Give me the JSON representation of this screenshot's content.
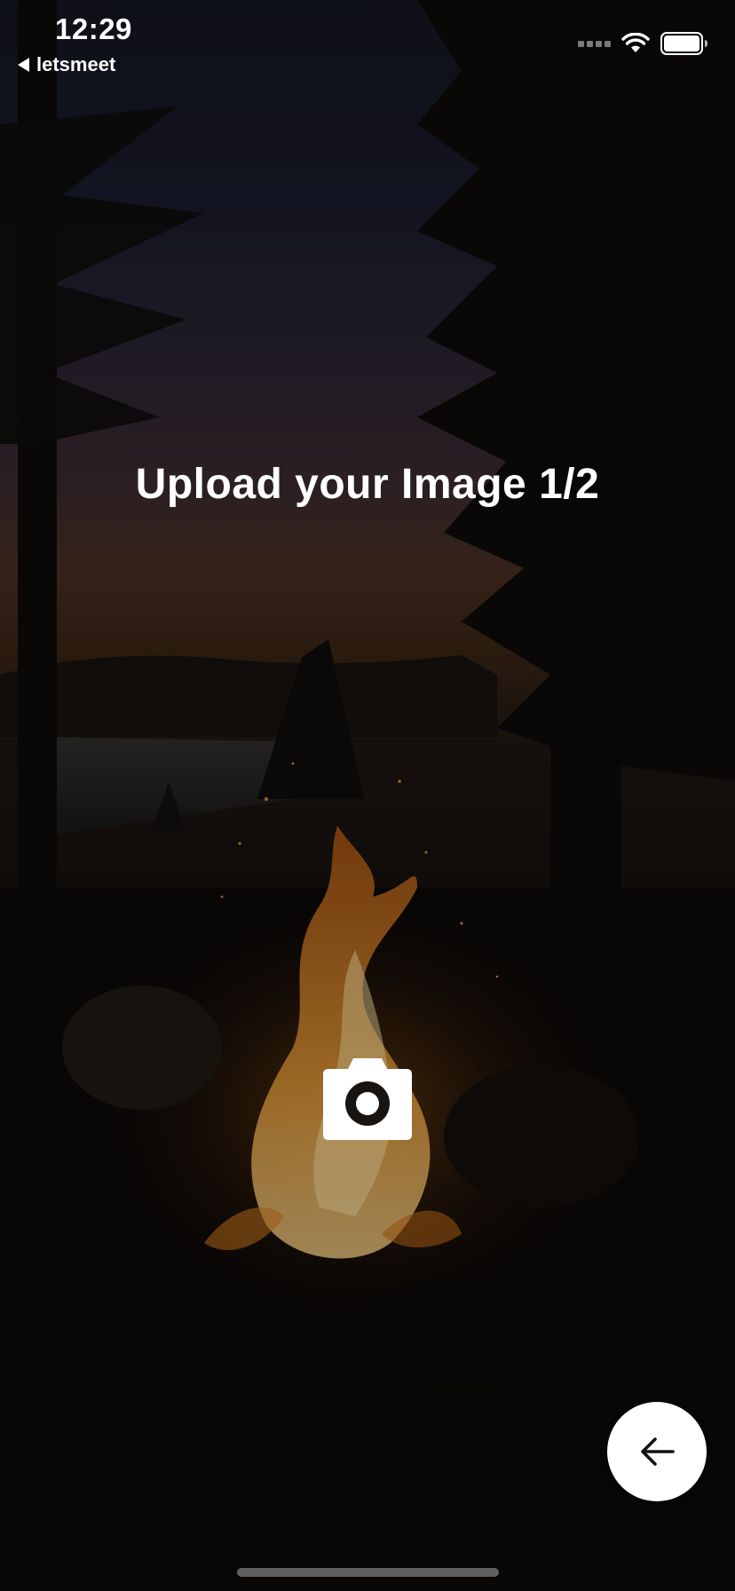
{
  "status_bar": {
    "time": "12:29",
    "back_app_label": "letsmeet",
    "icons": [
      "cellular-signal-icon",
      "wifi-icon",
      "battery-icon"
    ]
  },
  "title": "Upload your Image 1/2",
  "camera": {
    "icon": "camera-icon"
  },
  "fab": {
    "icon": "arrow-left-icon"
  },
  "colors": {
    "text": "#ffffff",
    "fab_background": "#ffffff",
    "fab_icon": "#111111",
    "home_indicator": "#5f5f5f"
  }
}
